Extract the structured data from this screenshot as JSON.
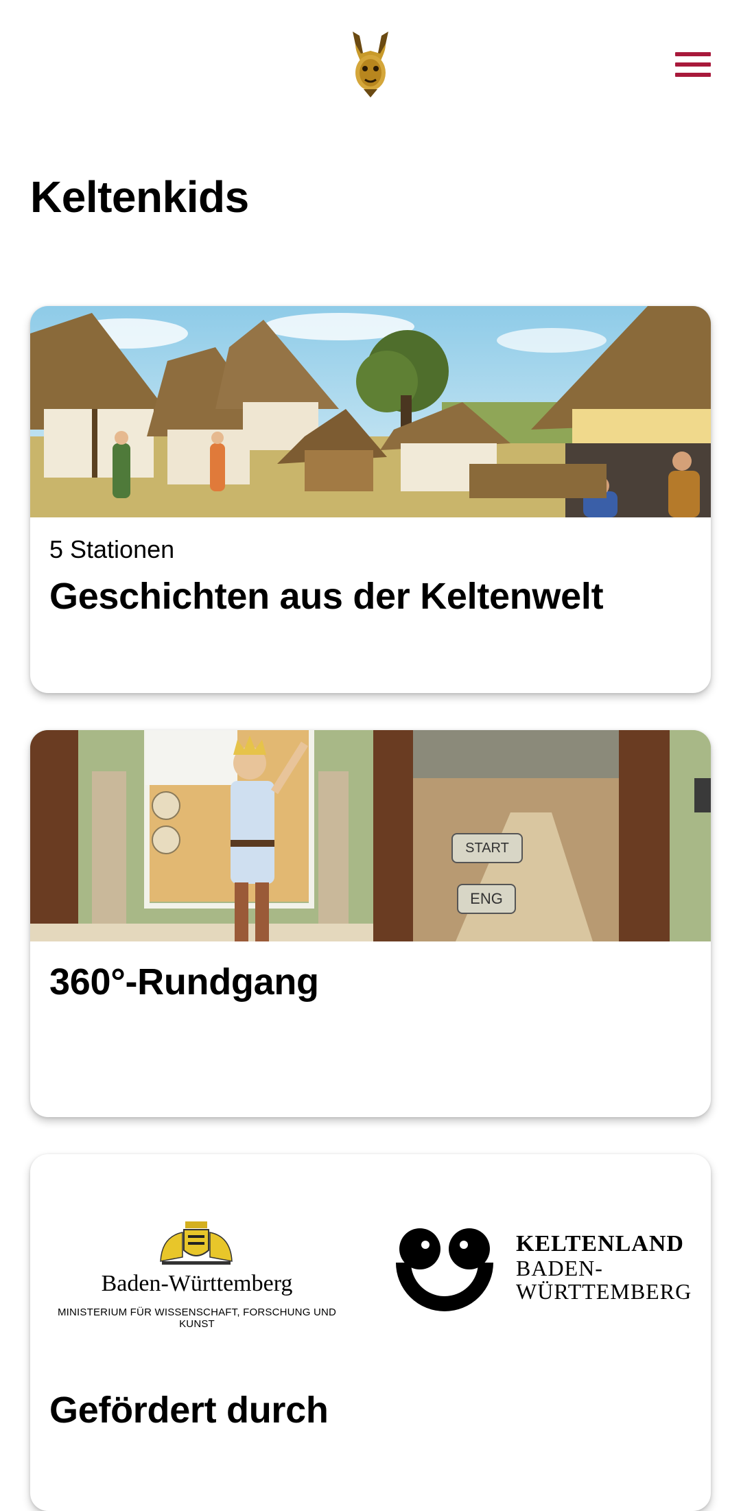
{
  "header": {
    "logo_icon": "celtic-bronze-head-logo-icon",
    "menu_icon": "hamburger-menu-icon",
    "accent_color": "#a8193b"
  },
  "page": {
    "title": "Keltenkids"
  },
  "cards": [
    {
      "subtitle": "5 Stationen",
      "title": "Geschichten aus der Keltenwelt",
      "image": "illustrated Celtic village with thatched houses"
    },
    {
      "title": "360°-Rundgang",
      "image": "museum panorama with illustrated Celtic boy",
      "image_buttons": [
        "START",
        "ENG"
      ]
    },
    {
      "title": "Gefördert durch",
      "sponsors": {
        "bw": {
          "name": "Baden-Württemberg",
          "ministry": "MINISTERIUM FÜR WISSENSCHAFT, FORSCHUNG UND KUNST"
        },
        "keltenland": {
          "line1": "KELTENLAND",
          "line2": "BADEN-",
          "line3": "WÜRTTEMBERG"
        }
      }
    }
  ]
}
